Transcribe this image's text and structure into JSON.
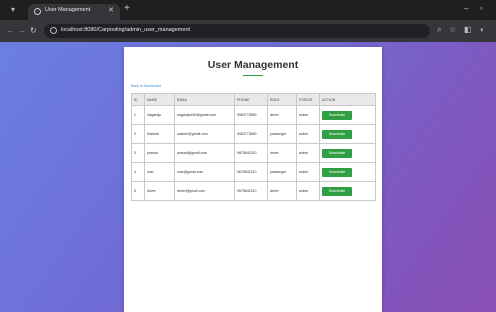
{
  "browser": {
    "tab_title": "User Management",
    "url": "localhost:8080/Carpooling/admin_user_management"
  },
  "page": {
    "title": "User Management",
    "back_link": "Back to Dashboard"
  },
  "table": {
    "headers": [
      "ID",
      "NAME",
      "EMAIL",
      "PHONE",
      "ROLE",
      "STATUS",
      "ACTION"
    ],
    "rows": [
      [
        "1",
        "Nagaraju",
        "nagaraju440@gmail.com",
        "9963773890",
        "driver",
        "active",
        "Deactivate"
      ],
      [
        "2",
        "Sakeeb",
        "sakeeb@gmail.com",
        "9963773890",
        "passenger",
        "active",
        "Deactivate"
      ],
      [
        "3",
        "prasad",
        "prasad@gmail.com",
        "9675642210",
        "driver",
        "active",
        "Deactivate"
      ],
      [
        "4",
        "user",
        "user@gmail.com",
        "9675642210",
        "passenger",
        "active",
        "Deactivate"
      ],
      [
        "5",
        "driver",
        "driver@gmail.com",
        "9675642210",
        "driver",
        "active",
        "Deactivate"
      ]
    ]
  },
  "colors": {
    "accent": "#2ea043",
    "link": "#3b8fd9",
    "background_start": "#6b7fe3",
    "background_end": "#8a4fb5"
  }
}
